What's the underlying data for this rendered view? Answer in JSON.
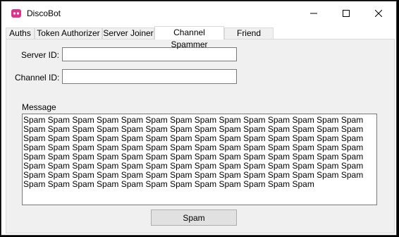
{
  "window": {
    "title": "DiscoBot",
    "icon": "discord-logo-icon",
    "accent_color": "#e0328c"
  },
  "tabs": [
    {
      "label": "Auths",
      "selected": false
    },
    {
      "label": "Token Authorizer",
      "selected": false
    },
    {
      "label": "Server Joiner",
      "selected": false
    },
    {
      "label": "Channel Spammer",
      "selected": true
    },
    {
      "label": "Friend Adder",
      "selected": false
    }
  ],
  "form": {
    "server_id_label": "Server ID:",
    "server_id_value": "",
    "channel_id_label": "Channel ID:",
    "channel_id_value": "",
    "message_label": "Message",
    "message_value": "Spam Spam Spam Spam Spam Spam Spam Spam Spam Spam Spam Spam Spam Spam Spam Spam Spam Spam Spam Spam Spam Spam Spam Spam Spam Spam Spam Spam Spam Spam Spam Spam Spam Spam Spam Spam Spam Spam Spam Spam Spam Spam Spam Spam Spam Spam Spam Spam Spam Spam Spam Spam Spam Spam Spam Spam Spam Spam Spam Spam Spam Spam Spam Spam Spam Spam Spam Spam Spam Spam Spam Spam Spam Spam Spam Spam Spam Spam Spam Spam Spam Spam Spam Spam Spam Spam Spam Spam Spam Spam Spam Spam Spam Spam Spam Spam Spam Spam Spam Spam Spam Spam Spam Spam Spam Spam Spam Spam Spam Spam",
    "spam_button_label": "Spam"
  }
}
